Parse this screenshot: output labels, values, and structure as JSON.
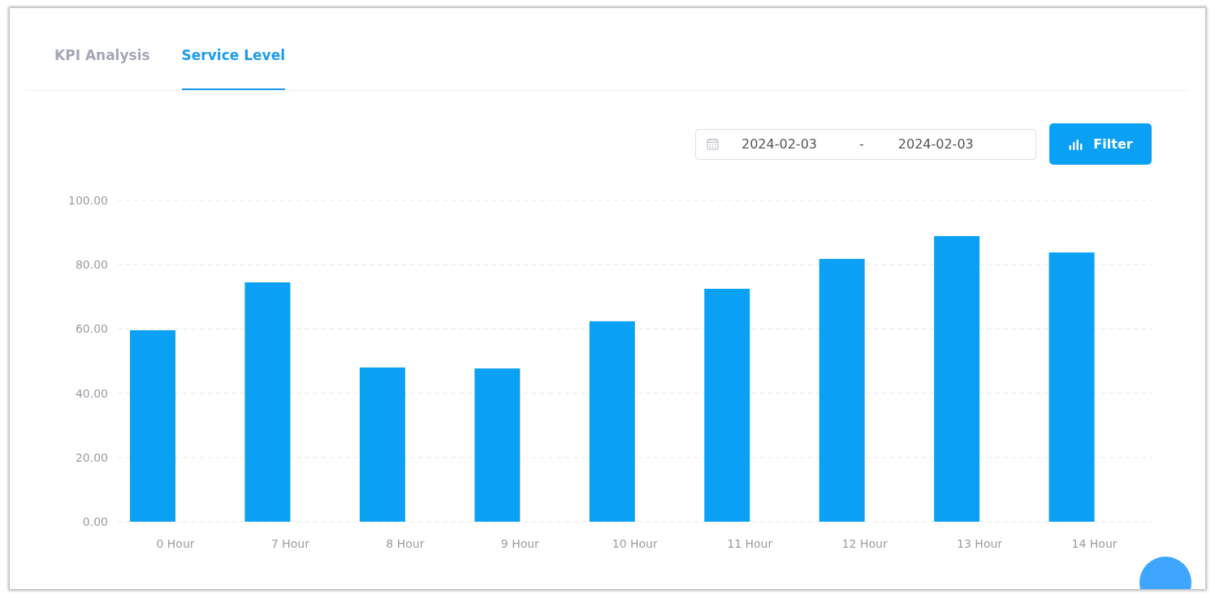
{
  "tabs": [
    {
      "label": "KPI Analysis",
      "selected": false
    },
    {
      "label": "Service Level",
      "selected": true
    }
  ],
  "date_range": {
    "start": "2024-02-03",
    "separator": "-",
    "end": "2024-02-03"
  },
  "filter_button": {
    "label": "Filter"
  },
  "chart_data": {
    "type": "bar",
    "categories": [
      "0 Hour",
      "7 Hour",
      "8 Hour",
      "9 Hour",
      "10 Hour",
      "11 Hour",
      "12 Hour",
      "13 Hour",
      "14 Hour"
    ],
    "grid": true,
    "series": [
      {
        "color": "#0aa1f5",
        "values": [
          59.6,
          74.5,
          48.0,
          47.7,
          62.4,
          72.5,
          81.8,
          88.9,
          83.8
        ]
      }
    ],
    "ylim": [
      0,
      100
    ],
    "yticks": [
      {
        "value": 0,
        "label": "0.00"
      },
      {
        "value": 20,
        "label": "20.00"
      },
      {
        "value": 40,
        "label": "40.00"
      },
      {
        "value": 60,
        "label": "60.00"
      },
      {
        "value": 80,
        "label": "80.00"
      },
      {
        "value": 100,
        "label": "100.00"
      }
    ]
  }
}
